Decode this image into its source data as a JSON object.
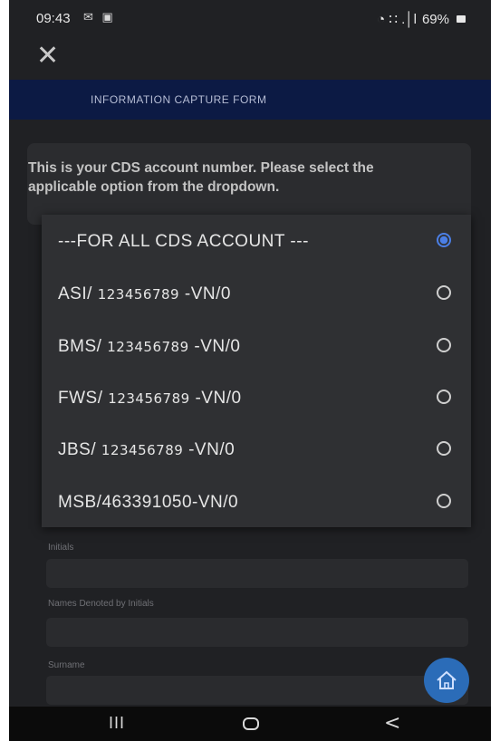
{
  "status_bar": {
    "time": "09:43",
    "left_icons": "✉ ▣",
    "signal": "◔ ∷ .│l",
    "battery": "69%"
  },
  "header": {
    "close_icon": "✕",
    "form_title": "INFORMATION CAPTURE FORM"
  },
  "prompt": "This is your CDS account number. Please select the applicable option from the dropdown.",
  "dropdown": {
    "options": [
      {
        "prefix": "---FOR ALL CDS ACCOUNT ---",
        "number": "",
        "suffix": "",
        "selected": true
      },
      {
        "prefix": "ASI/ ",
        "number": "123456789",
        "suffix": " -VN/0",
        "selected": false
      },
      {
        "prefix": "BMS/ ",
        "number": "123456789",
        "suffix": " -VN/0",
        "selected": false
      },
      {
        "prefix": "FWS/ ",
        "number": "123456789",
        "suffix": " -VN/0",
        "selected": false
      },
      {
        "prefix": "JBS/ ",
        "number": "123456789",
        "suffix": " -VN/0",
        "selected": false
      },
      {
        "prefix": "MSB/463391050-VN/0",
        "number": "",
        "suffix": "",
        "selected": false
      }
    ]
  },
  "fields": {
    "initials_label": "Initials",
    "names_label": "Names Denoted by Initials",
    "surname_label": "Surname"
  },
  "nav": {
    "recent": "III",
    "back": "<"
  },
  "colors": {
    "background": "#202124",
    "banner": "#0c1a44",
    "accent": "#4b7fe6",
    "fab": "#2b6cb8"
  }
}
